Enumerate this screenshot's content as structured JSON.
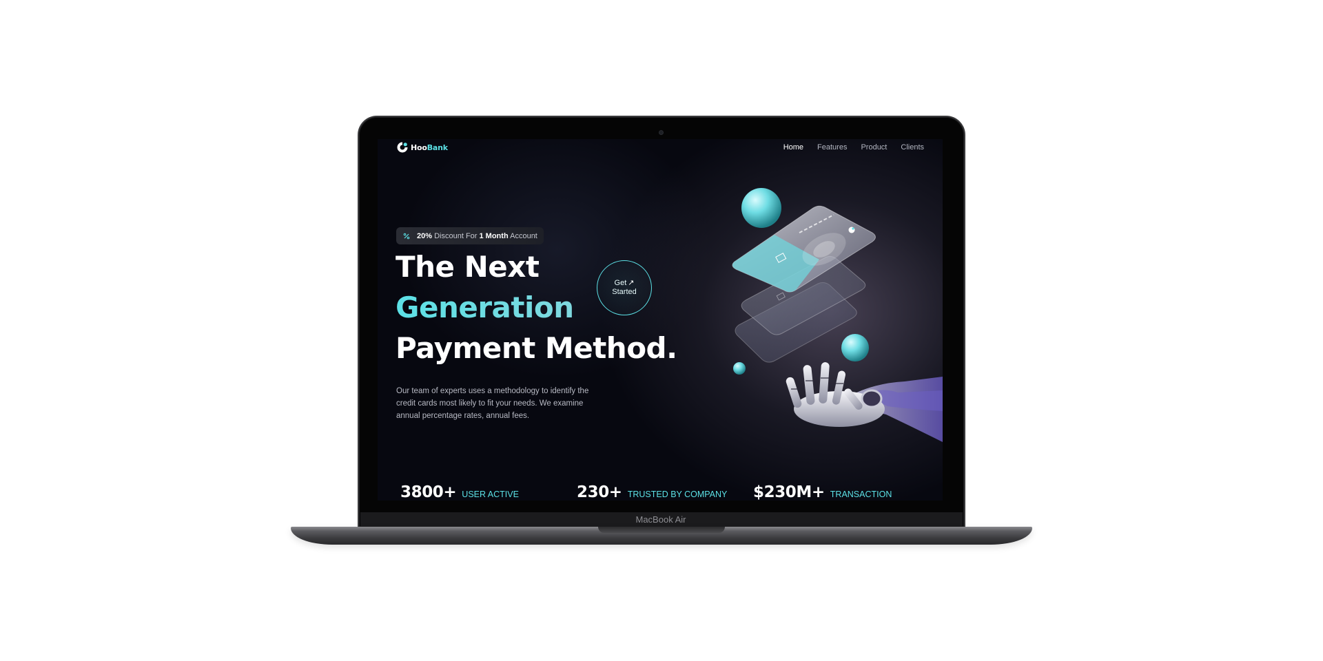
{
  "device": {
    "label": "MacBook Air"
  },
  "site": {
    "brand_part1": "Hoo",
    "brand_part2": "Bank",
    "nav": [
      "Home",
      "Features",
      "Product",
      "Clients"
    ],
    "active_nav": "Home"
  },
  "hero": {
    "badge": {
      "percent": "20%",
      "text1": " Discount For ",
      "period": "1 Month",
      "text2": " Account"
    },
    "title_line1": "The Next",
    "title_line2": "Generation",
    "title_line3": "Payment Method.",
    "description": "Our team of experts uses a methodology to identify the credit cards most likely to fit your needs. We examine annual percentage rates, annual fees.",
    "cta_line1": "Get",
    "cta_arrow": "↗",
    "cta_line2": "Started"
  },
  "stats": [
    {
      "value": "3800+",
      "label": "USER ACTIVE"
    },
    {
      "value": "230+",
      "label": "TRUSTED BY COMPANY"
    },
    {
      "value": "$230M+",
      "label": "TRANSACTION"
    }
  ],
  "colors": {
    "accent": "#5ce1e6",
    "background": "#070810",
    "text": "#ffffff",
    "muted": "#b8bac4"
  },
  "icons": {
    "logo": "hoobank-logo-icon",
    "badge": "discount-icon",
    "cta": "arrow-up-right-icon"
  }
}
